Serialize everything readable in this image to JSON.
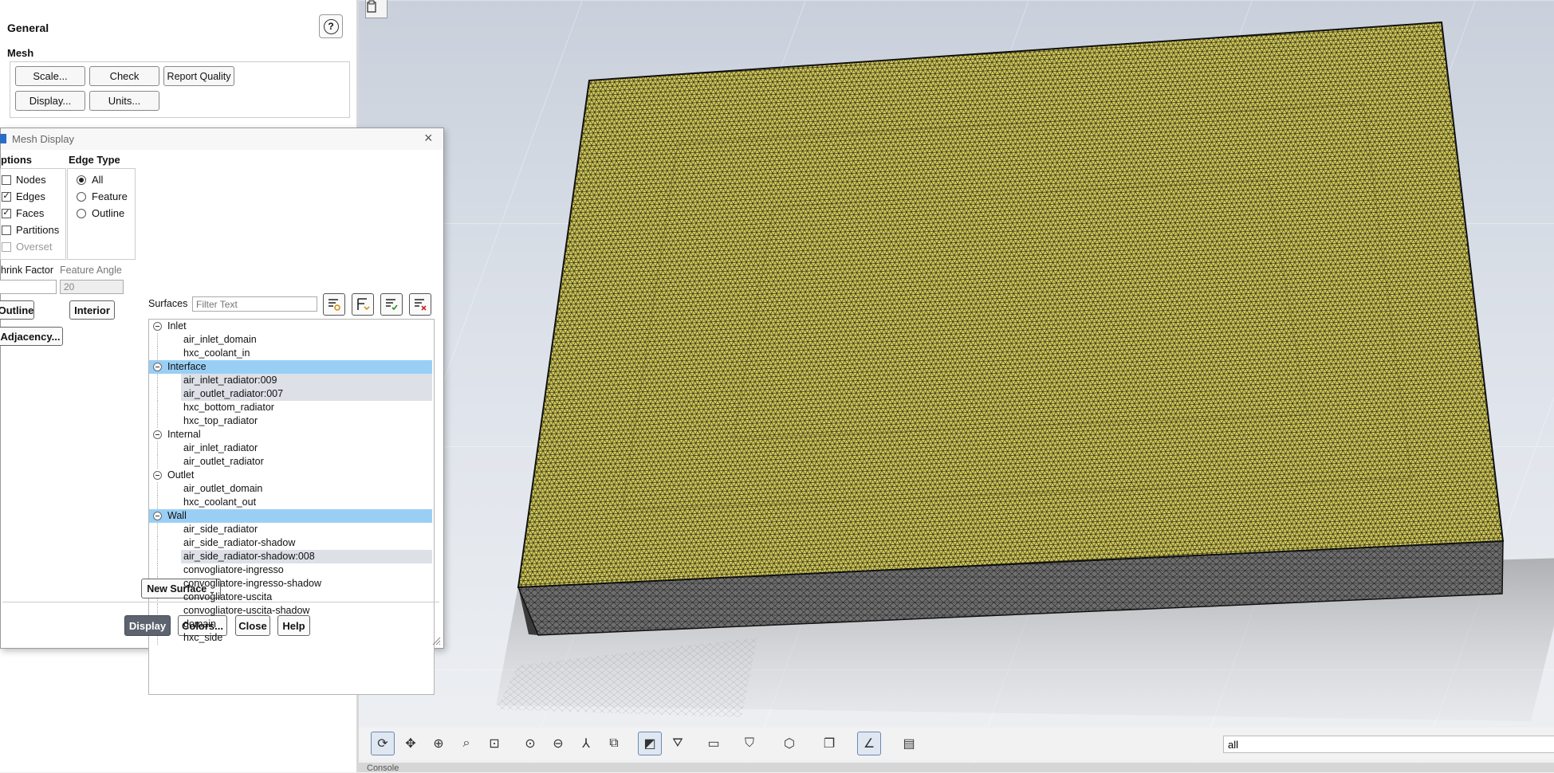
{
  "general_panel": {
    "title": "General",
    "mesh_label": "Mesh",
    "buttons": {
      "scale": "Scale...",
      "check": "Check",
      "report_quality": "Report Quality",
      "display": "Display...",
      "units": "Units..."
    }
  },
  "dialog": {
    "title": "Mesh Display",
    "options": {
      "label": "ptions",
      "nodes": {
        "label": "Nodes",
        "checked": false
      },
      "edges": {
        "label": "Edges",
        "checked": true
      },
      "faces": {
        "label": "Faces",
        "checked": true
      },
      "partitions": {
        "label": "Partitions",
        "checked": false
      },
      "overset": {
        "label": "Overset",
        "checked": false
      }
    },
    "edge_type": {
      "label": "Edge Type",
      "all": "All",
      "feature": "Feature",
      "outline": "Outline",
      "selected": "All"
    },
    "shrink_factor_label": "hrink Factor",
    "shrink_factor_value": "",
    "feature_angle_label": "Feature Angle",
    "feature_angle_value": "20",
    "outline_button": "Outline",
    "interior_button": "Interior",
    "adjacency_button": "Adjacency...",
    "surfaces_label": "Surfaces",
    "filter_placeholder": "Filter Text",
    "tree": [
      {
        "group": "Inlet",
        "selected": false,
        "items": [
          {
            "name": "air_inlet_domain",
            "selected": false
          },
          {
            "name": "hxc_coolant_in",
            "selected": false
          }
        ]
      },
      {
        "group": "Interface",
        "selected": true,
        "items": [
          {
            "name": "air_inlet_radiator:009",
            "selected": true
          },
          {
            "name": "air_outlet_radiator:007",
            "selected": true
          },
          {
            "name": "hxc_bottom_radiator",
            "selected": false
          },
          {
            "name": "hxc_top_radiator",
            "selected": false
          }
        ]
      },
      {
        "group": "Internal",
        "selected": false,
        "items": [
          {
            "name": "air_inlet_radiator",
            "selected": false
          },
          {
            "name": "air_outlet_radiator",
            "selected": false
          }
        ]
      },
      {
        "group": "Outlet",
        "selected": false,
        "items": [
          {
            "name": "air_outlet_domain",
            "selected": false
          },
          {
            "name": "hxc_coolant_out",
            "selected": false
          }
        ]
      },
      {
        "group": "Wall",
        "selected": true,
        "items": [
          {
            "name": "air_side_radiator",
            "selected": false
          },
          {
            "name": "air_side_radiator-shadow",
            "selected": false
          },
          {
            "name": "air_side_radiator-shadow:008",
            "selected": true
          },
          {
            "name": "convogliatore-ingresso",
            "selected": false
          },
          {
            "name": "convogliatore-ingresso-shadow",
            "selected": false
          },
          {
            "name": "convogliatore-uscita",
            "selected": false
          },
          {
            "name": "convogliatore-uscita-shadow",
            "selected": false
          },
          {
            "name": "domain",
            "selected": false
          },
          {
            "name": "hxc_side",
            "selected": false
          }
        ]
      }
    ],
    "new_surface_button": "New Surface",
    "footer": {
      "display": "Display",
      "colors": "Colors...",
      "close": "Close",
      "help": "Help"
    }
  },
  "graphics": {
    "view_input_value": "all",
    "console_label": "Console",
    "mesh_face_color": "#d6cd5a",
    "mesh_side_color": "#6e6e6e"
  }
}
